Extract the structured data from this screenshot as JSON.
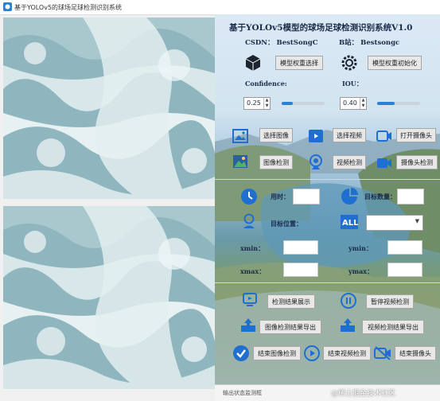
{
  "window": {
    "title": "基于YOLOv5的球场足球检测识别系统"
  },
  "header": {
    "title": "基于YOLOv5模型的球场足球检测识别系统V1.0",
    "csdn": "CSDN：  BestSongC",
    "bilibili": "B站：  Bestsongc"
  },
  "model": {
    "select_label": "模型权重选择",
    "init_label": "模型权重初始化"
  },
  "params": {
    "confidence_label": "Confidence:",
    "confidence_value": "0.25",
    "confidence_level": 0.25,
    "iou_label": "IOU：",
    "iou_value": "0.40",
    "iou_level": 0.4
  },
  "source_buttons": {
    "select_image": "选择图像",
    "select_video": "选择视频",
    "open_camera": "打开摄像头",
    "image_detect": "图像检测",
    "video_detect": "视频检测",
    "camera_detect": "摄像头检测"
  },
  "results": {
    "time_label": "用时：",
    "count_label": "目标数量：",
    "position_label": "目标位置：",
    "xmin_label": "xmin：",
    "ymin_label": "ymin：",
    "xmax_label": "xmax：",
    "ymax_label": "ymax："
  },
  "actions": {
    "show_results": "检测结果展示",
    "pause_video": "暂停视频检测",
    "export_image": "图像检测结果导出",
    "export_video": "视频检测结果导出",
    "end_image": "结束图像检测",
    "end_video": "结束视频检测",
    "end_camera": "结束摄像头"
  },
  "status": {
    "placeholder": "输出状态监测框"
  },
  "watermark": "@稀土掘金技术社区",
  "colors": {
    "accent": "#2a7fd6",
    "button_bg": "#e8e8e8",
    "water": "#8fb6bf",
    "foam": "#e8f1f2"
  }
}
